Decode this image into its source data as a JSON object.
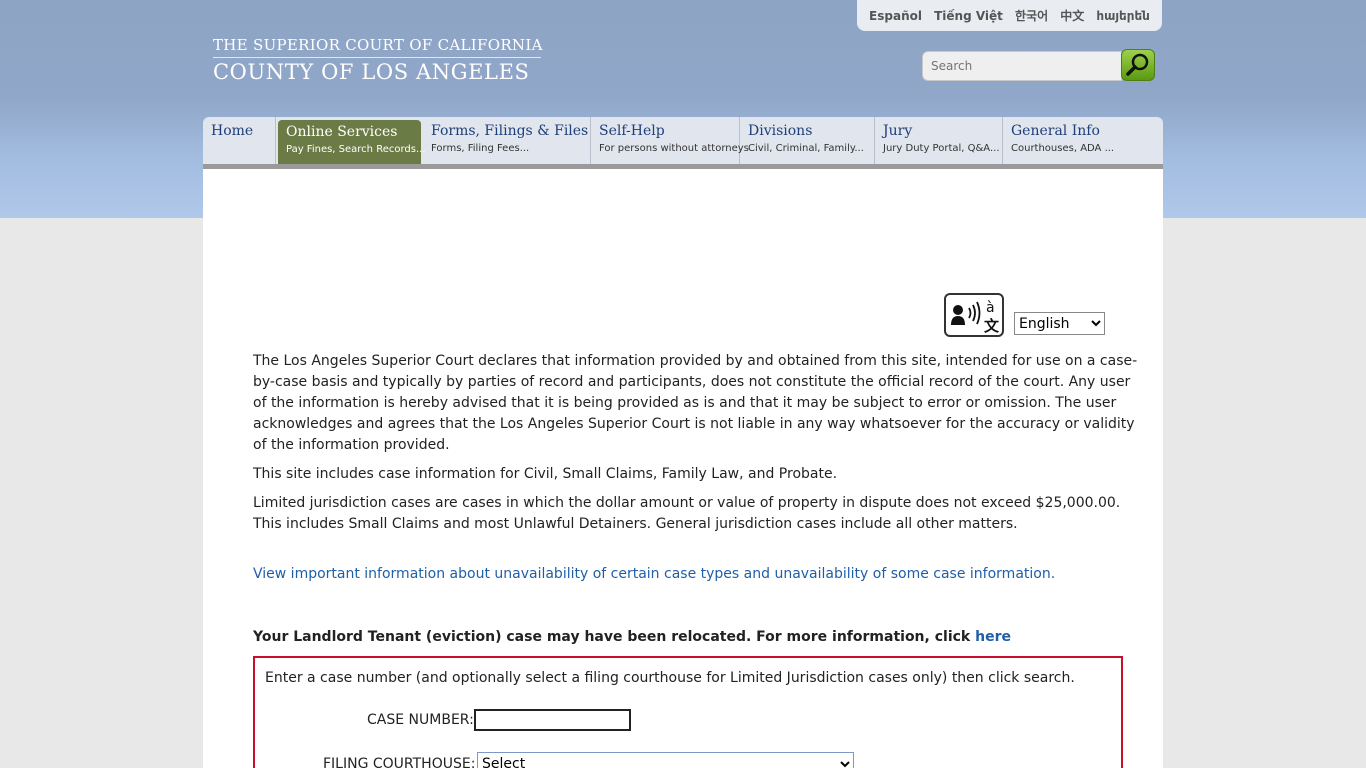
{
  "languages": [
    "Español",
    "Tiếng Việt",
    "한국어",
    "中文",
    "հայերեն"
  ],
  "logo": {
    "line1": "THE SUPERIOR COURT OF CALIFORNIA",
    "line2": "COUNTY OF LOS ANGELES"
  },
  "search": {
    "placeholder": "Search"
  },
  "nav": [
    {
      "title": "Home",
      "subtitle": ""
    },
    {
      "title": "Online Services",
      "subtitle": "Pay Fines, Search Records..."
    },
    {
      "title": "Forms, Filings & Files",
      "subtitle": "Forms, Filing Fees..."
    },
    {
      "title": "Self-Help",
      "subtitle": "For persons without attorneys"
    },
    {
      "title": "Divisions",
      "subtitle": "Civil, Criminal, Family..."
    },
    {
      "title": "Jury",
      "subtitle": "Jury Duty Portal, Q&A..."
    },
    {
      "title": "General Info",
      "subtitle": "Courthouses, ADA ..."
    }
  ],
  "translate": {
    "selected": "English"
  },
  "content": {
    "disclaimer": "The Los Angeles Superior Court declares that information provided by and obtained from this site, intended for use on a case-by-case basis and typically by parties of record and participants, does not constitute the official record of the court. Any user of the information is hereby advised that it is being provided as is and that it may be subject to error or omission. The user acknowledges and agrees that the Los Angeles Superior Court is not liable in any way whatsoever for the accuracy or validity of the information provided.",
    "site_includes": "This site includes case information for Civil, Small Claims, Family Law, and Probate.",
    "jurisdiction": "Limited jurisdiction cases are cases in which the dollar amount or value of property in dispute does not exceed $25,000.00. This includes Small Claims and most Unlawful Detainers. General jurisdiction cases include all other matters.",
    "unavailability_link": "View important information about unavailability of certain case types and unavailability of some case information.",
    "relocated_text": "Your Landlord Tenant (eviction) case may have been relocated. For more information, click",
    "relocated_link": "here"
  },
  "case_search": {
    "instructions": "Enter a case number (and optionally select a filing courthouse for Limited Jurisdiction cases only) then click search.",
    "case_number_label": "CASE NUMBER:",
    "case_number_value": "",
    "courthouse_label": "FILING COURTHOUSE:",
    "courthouse_selected": "Select"
  },
  "colors": {
    "active_nav": "#6b7b45",
    "panel_border": "#c7102b",
    "link": "#1f5fa8"
  }
}
